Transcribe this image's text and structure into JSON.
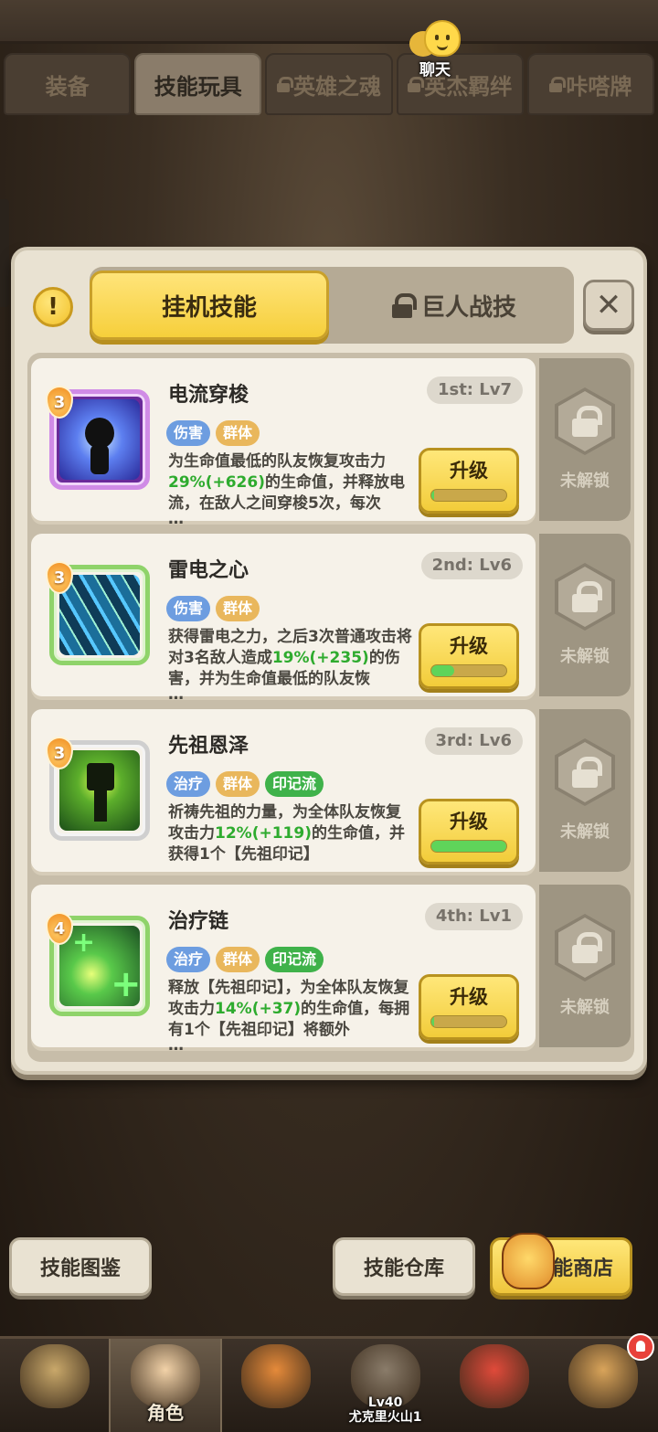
{
  "top_tabs": [
    {
      "label": "装备",
      "locked": false,
      "active": false
    },
    {
      "label": "技能玩具",
      "locked": false,
      "active": true
    },
    {
      "label": "英雄之魂",
      "locked": true,
      "active": false
    },
    {
      "label": "英杰羁绊",
      "locked": true,
      "active": false
    },
    {
      "label": "咔嗒牌",
      "locked": true,
      "active": false
    }
  ],
  "chat": {
    "label": "聊天"
  },
  "panel": {
    "tip_symbol": "!",
    "tab_active": "挂机技能",
    "tab_locked": "巨人战技",
    "close_symbol": "✕",
    "upgrade_label": "升级",
    "locked_slot_label": "未解锁"
  },
  "skills": [
    {
      "name": "电流穿梭",
      "rank": "1st: Lv7",
      "badge": "3",
      "frame": "purple",
      "art": "electric",
      "tags": [
        {
          "text": "伤害",
          "color": "blue"
        },
        {
          "text": "群体",
          "color": "orange"
        }
      ],
      "desc_parts": [
        "为生命值最低的队友恢复攻击力",
        "29%(+626)",
        "的生命值，并释放电流，在敌人之间穿梭5次，每次"
      ],
      "more": "…",
      "progress": 0.04
    },
    {
      "name": "雷电之心",
      "rank": "2nd: Lv6",
      "badge": "3",
      "frame": "green",
      "art": "storm",
      "tags": [
        {
          "text": "伤害",
          "color": "blue"
        },
        {
          "text": "群体",
          "color": "orange"
        }
      ],
      "desc_parts": [
        "获得雷电之力，之后3次普通攻击将对3名敌人造成",
        "19%(+235)",
        "的伤害，并为生命值最低的队友恢"
      ],
      "more": "…",
      "progress": 0.3
    },
    {
      "name": "先祖恩泽",
      "rank": "3rd: Lv6",
      "badge": "3",
      "frame": "gray",
      "art": "ancestor",
      "tags": [
        {
          "text": "治疗",
          "color": "blue"
        },
        {
          "text": "群体",
          "color": "orange"
        },
        {
          "text": "印记流",
          "color": "green"
        }
      ],
      "desc_parts": [
        "祈祷先祖的力量，为全体队友恢复攻击力",
        "12%(+119)",
        "的生命值，并获得1个【先祖印记】"
      ],
      "more": "",
      "progress": 1.0
    },
    {
      "name": "治疗链",
      "rank": "4th: Lv1",
      "badge": "4",
      "frame": "green",
      "art": "chain",
      "tags": [
        {
          "text": "治疗",
          "color": "blue"
        },
        {
          "text": "群体",
          "color": "orange"
        },
        {
          "text": "印记流",
          "color": "green"
        }
      ],
      "desc_parts": [
        "释放【先祖印记】，为全体队友恢复攻击力",
        "14%(+37)",
        "的生命值，每拥有1个【先祖印记】将额外"
      ],
      "more": "…",
      "progress": 0.04
    }
  ],
  "bottom_buttons": {
    "codex": "技能图鉴",
    "storage": "技能仓库",
    "shop": "技能商店"
  },
  "navbar": [
    {
      "label": "",
      "sub": "",
      "active": false,
      "color": "#c9a86a"
    },
    {
      "label": "角色",
      "sub": "",
      "active": true,
      "color": "#f2d2a8"
    },
    {
      "label": "",
      "sub": "",
      "active": false,
      "color": "#e58a3a"
    },
    {
      "label": "",
      "sub": "Lv40\n尤克里火山1",
      "active": false,
      "color": "#8a7c6a"
    },
    {
      "label": "",
      "sub": "",
      "active": false,
      "color": "#e04a3a"
    },
    {
      "label": "",
      "sub": "",
      "active": false,
      "color": "#d9a45a"
    }
  ]
}
